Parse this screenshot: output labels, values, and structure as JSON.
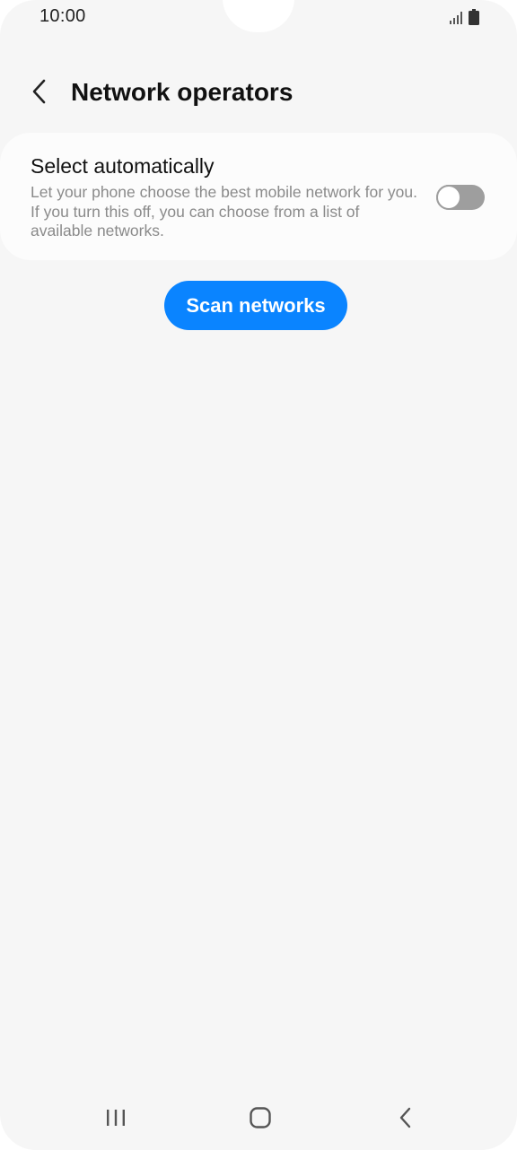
{
  "status_bar": {
    "time": "10:00",
    "icons": [
      "signal-icon",
      "battery-icon"
    ]
  },
  "app_bar": {
    "title": "Network operators",
    "back_icon": "chevron-left-icon"
  },
  "settings": {
    "select_automatically": {
      "title": "Select automatically",
      "description": "Let your phone choose the best mobile network for you. If you turn this off, you can choose from a list of available networks.",
      "enabled": false
    }
  },
  "actions": {
    "scan_label": "Scan networks"
  },
  "nav_bar": {
    "items": [
      "recent-apps-icon",
      "home-icon",
      "back-icon"
    ]
  },
  "colors": {
    "accent": "#0a84ff",
    "background": "#f6f6f6",
    "card": "#fcfcfc",
    "toggle_off": "#9e9e9e"
  }
}
